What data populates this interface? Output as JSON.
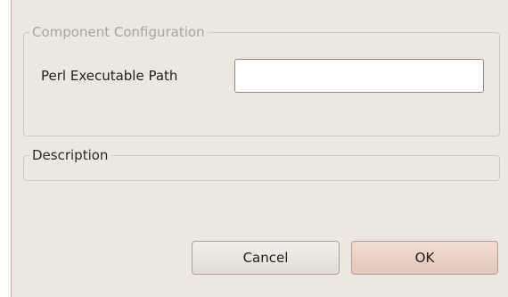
{
  "config_group": {
    "title": "Component Configuration",
    "path_label": "Perl Executable Path",
    "path_value": ""
  },
  "description_group": {
    "title": "Description"
  },
  "buttons": {
    "cancel": "Cancel",
    "ok": "OK"
  }
}
